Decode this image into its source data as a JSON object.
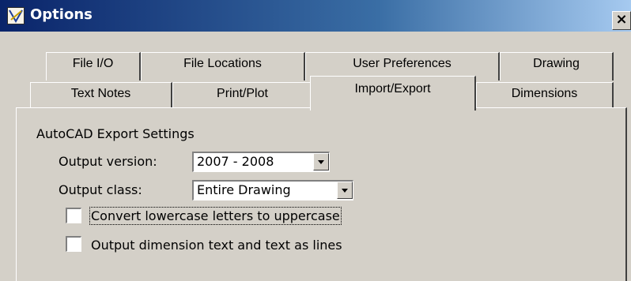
{
  "window": {
    "title": "Options",
    "close_glyph": "×",
    "app_icon": "autocad-options-icon"
  },
  "tabs_row1": [
    {
      "label": "File I/O"
    },
    {
      "label": "File Locations"
    },
    {
      "label": "User Preferences"
    },
    {
      "label": "Drawing"
    }
  ],
  "tabs_row2": [
    {
      "label": "Text Notes"
    },
    {
      "label": "Print/Plot"
    },
    {
      "label": "Import/Export",
      "selected": true
    },
    {
      "label": "Dimensions"
    }
  ],
  "panel": {
    "section_title": "AutoCAD Export Settings",
    "output_version": {
      "label": "Output version:",
      "value": "2007 - 2008"
    },
    "output_class": {
      "label": "Output class:",
      "value": "Entire Drawing"
    },
    "checkbox_uppercase": {
      "label": "Convert lowercase letters to uppercase",
      "checked": false
    },
    "checkbox_lines": {
      "label": "Output dimension text and text as lines",
      "checked": false
    }
  }
}
